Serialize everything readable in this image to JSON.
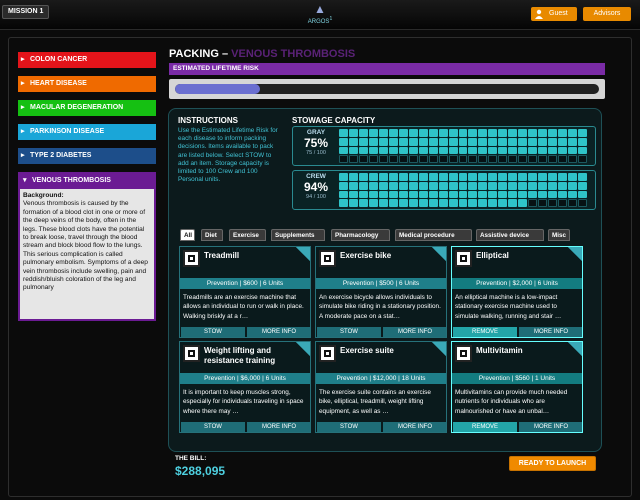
{
  "topbar": {
    "mission_label": "MISSION 1",
    "logo_text": "ARGOS",
    "logo_sup": "1",
    "guest_label": "Guest",
    "advisors_label": "Advisors",
    "accent_color": "#e88a00"
  },
  "sidebar": {
    "diseases": [
      {
        "label": "COLON CANCER",
        "color": "#e3141a"
      },
      {
        "label": "HEART DISEASE",
        "color": "#ef6a00"
      },
      {
        "label": "MACULAR DEGENERATION",
        "color": "#15c012"
      },
      {
        "label": "PARKINSON DISEASE",
        "color": "#1aa6d8"
      },
      {
        "label": "TYPE 2 DIABETES",
        "color": "#1d4e8a"
      }
    ],
    "active": {
      "label": "VENOUS THROMBOSIS",
      "color": "#6b1b93",
      "background_heading": "Background:",
      "background_text": "Venous thrombosis is caused by the formation of a blood clot in one or more of the deep veins of the body, often in the legs. These blood clots have the potential to break loose, travel through the blood stream and block blood flow to the lungs. This serious complication is called pulmonary embolism. Symptoms of a deep vein thrombosis include swelling, pain and reddish/bluish coloration of the leg and pulmonary"
    }
  },
  "packing": {
    "title_prefix": "PACKING –",
    "disease_name": "VENOUS THROMBOSIS",
    "risk_label": "ESTIMATED LIFETIME RISK",
    "risk_fraction": 0.2
  },
  "instructions": {
    "title": "INSTRUCTIONS",
    "text": "Use the Estimated Lifetime Risk for each disease to inform packing decisions. Items available to pack are listed below. Select STOW to add an item. Storage capacity is limited to 100 Crew and 100 Personal units."
  },
  "stowage": {
    "title": "STOWAGE CAPACITY",
    "gray": {
      "label": "GRAY",
      "percent": "75%",
      "count": "75 / 100",
      "used": 75,
      "total": 100
    },
    "crew": {
      "label": "CREW",
      "percent": "94%",
      "count": "94 / 100",
      "used": 94,
      "total": 100
    }
  },
  "tabs": [
    {
      "label": "All",
      "active": true
    },
    {
      "label": "Diet"
    },
    {
      "label": "Exercise"
    },
    {
      "label": "Supplements"
    },
    {
      "label": "Pharmacology"
    },
    {
      "label": "Medical procedure"
    },
    {
      "label": "Assistive device"
    },
    {
      "label": "Misc"
    }
  ],
  "items": [
    {
      "name": "Treadmill",
      "meta": "Prevention  |  $600  |  6 Units",
      "desc": "Treadmills are an exercise machine that allows an individual to run or walk in place. Walking briskly at a r…",
      "action": "STOW",
      "more": "MORE INFO",
      "selected": false
    },
    {
      "name": "Exercise bike",
      "meta": "Prevention  |  $500  |  6 Units",
      "desc": "An exercise bicycle allows individuals to simulate bike riding in a stationary position. A moderate pace on a stat…",
      "action": "STOW",
      "more": "MORE INFO",
      "selected": false
    },
    {
      "name": "Elliptical",
      "meta": "Prevention  |  $2,000  |  6 Units",
      "desc": "An elliptical machine is a low-impact stationary exercise machine used to simulate walking, running and stair …",
      "action": "REMOVE",
      "more": "MORE INFO",
      "selected": true
    },
    {
      "name": "Weight lifting and resistance training",
      "meta": "Prevention  |  $6,000  |  6 Units",
      "desc": "It is important to keep muscles strong, especially for individuals traveling in space where there may …",
      "action": "STOW",
      "more": "MORE INFO",
      "selected": false
    },
    {
      "name": "Exercise suite",
      "meta": "Prevention  |  $12,000  |  18 Units",
      "desc": "The exercise suite contains an exercise bike, elliptical, treadmill, weight lifting equipment, as well as …",
      "action": "STOW",
      "more": "MORE INFO",
      "selected": false
    },
    {
      "name": "Multivitamin",
      "meta": "Prevention  |  $560  |  1 Units",
      "desc": "Multivitamins can provide much needed nutrients for individuals who are malnourished or have an unbal…",
      "action": "REMOVE",
      "more": "MORE INFO",
      "selected": true
    }
  ],
  "bill": {
    "label": "THE BILL:",
    "value": "$288,095",
    "launch_label": "READY TO LAUNCH"
  }
}
